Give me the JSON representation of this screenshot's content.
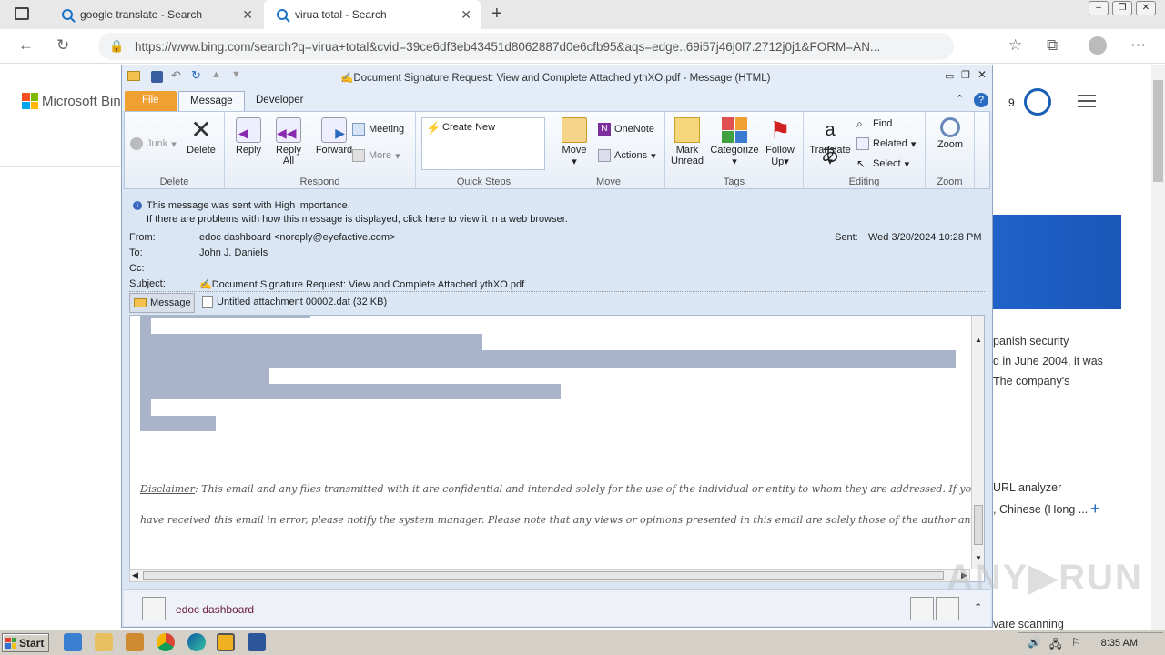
{
  "browser": {
    "tabs": [
      {
        "label": "google translate - Search"
      },
      {
        "label": "virua total - Search"
      }
    ],
    "url": "https://www.bing.com/search?q=virua+total&cvid=39ce6df3eb43451d8062887d0e6cfb95&aqs=edge..69i57j46j0l7.2712j0j1&FORM=AN..."
  },
  "bing": {
    "logo_text": "Microsoft Bin",
    "rewards_count": "9",
    "side_lines": [
      "panish security",
      "d in June 2004, it was",
      "The company's",
      "URL analyzer",
      ", Chinese (Hong ...",
      "vare scanning"
    ]
  },
  "outlook": {
    "title": "✍Document Signature Request: View and Complete Attached ythXO.pdf  -  Message (HTML)",
    "tabs": {
      "file": "File",
      "message": "Message",
      "developer": "Developer"
    },
    "ribbon": {
      "junk": "Junk",
      "delete": "Delete",
      "reply": "Reply",
      "reply_all_1": "Reply",
      "reply_all_2": "All",
      "forward": "Forward",
      "meeting": "Meeting",
      "more": "More",
      "create_new": "Create New",
      "move": "Move",
      "onenote": "OneNote",
      "actions": "Actions",
      "mark_1": "Mark",
      "mark_2": "Unread",
      "categorize": "Categorize",
      "follow_1": "Follow",
      "follow_2": "Up",
      "translate": "Translate",
      "find": "Find",
      "related": "Related",
      "select": "Select",
      "zoom": "Zoom",
      "groups": {
        "delete": "Delete",
        "respond": "Respond",
        "quick_steps": "Quick Steps",
        "move": "Move",
        "tags": "Tags",
        "editing": "Editing",
        "zoom": "Zoom"
      }
    },
    "header": {
      "importance": "This message was sent with High importance.",
      "view_browser": "If there are problems with how this message is displayed, click here to view it in a web browser.",
      "from_label": "From:",
      "from_value": "edoc dashboard <noreply@eyefactive.com>",
      "sent_label": "Sent:",
      "sent_value": "Wed 3/20/2024 10:28 PM",
      "to_label": "To:",
      "to_value": "John J. Daniels",
      "cc_label": "Cc:",
      "subject_label": "Subject:",
      "subject_value": "✍Document Signature Request: View and Complete Attached ythXO.pdf"
    },
    "message_tab": "Message",
    "attachment": "Untitled attachment 00002.dat (32 KB)",
    "disclaimer_label": "Disclaimer",
    "disclaimer_line1": ": This email and any files transmitted with it are confidential and intended solely for the use of the individual or entity to whom they are addressed. If you",
    "disclaimer_line2": "have received this email in error, please notify the system manager. Please note that any views or opinions presented in this email are solely those of the author and",
    "people_name": "edoc dashboard"
  },
  "taskbar": {
    "start": "Start",
    "clock": "8:35 AM"
  }
}
